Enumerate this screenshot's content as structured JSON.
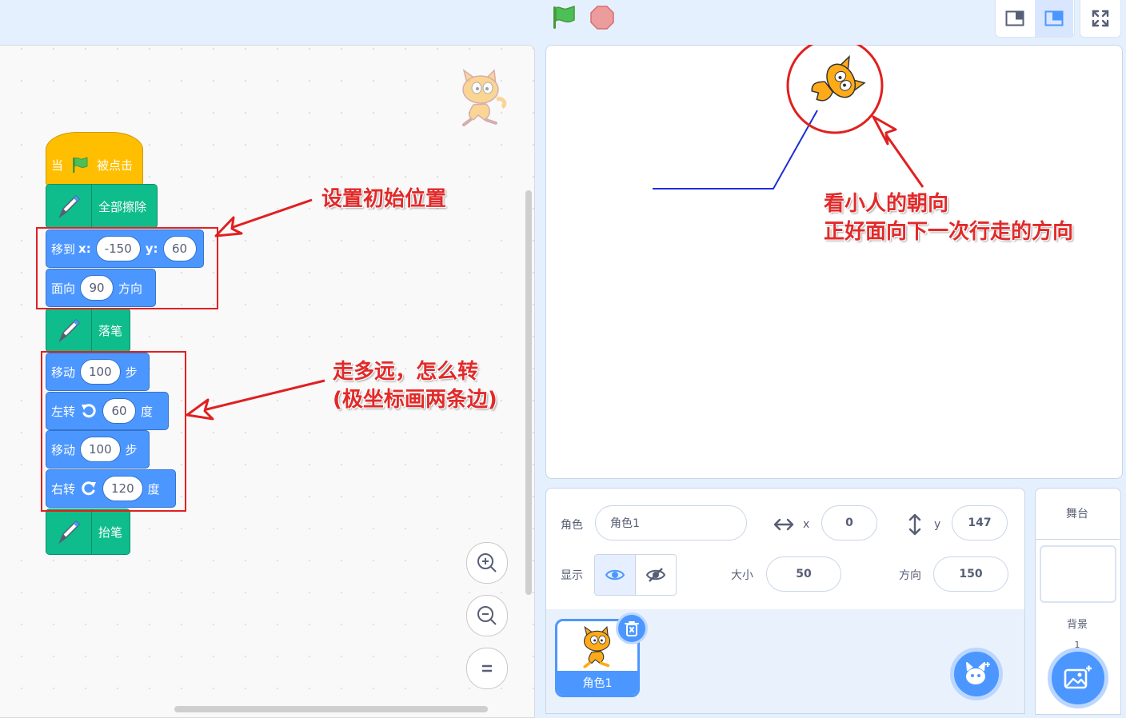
{
  "toolbar": {
    "green_flag": "green-flag-icon",
    "stop": "stop-icon",
    "layout_small": "small-stage-icon",
    "layout_normal": "normal-stage-icon",
    "fullscreen": "fullscreen-icon"
  },
  "blocks": {
    "hat_when": "当",
    "hat_clicked": "被点击",
    "clear_all": "全部擦除",
    "goto_label": "移到",
    "goto_x_label": "x:",
    "goto_x": "-150",
    "goto_y_label": "y:",
    "goto_y": "60",
    "point_label": "面向",
    "point_value": "90",
    "point_suffix": "方向",
    "pen_down": "落笔",
    "move1_label": "移动",
    "move1_value": "100",
    "move1_suffix": "步",
    "turn_left_label": "左转",
    "turn_left_value": "60",
    "turn_left_suffix": "度",
    "move2_label": "移动",
    "move2_value": "100",
    "move2_suffix": "步",
    "turn_right_label": "右转",
    "turn_right_value": "120",
    "turn_right_suffix": "度",
    "pen_up": "抬笔"
  },
  "annotations": {
    "initial_position": "设置初始位置",
    "distance_line1": "走多远，怎么转",
    "distance_line2": "(极坐标画两条边)",
    "stage_line1": "看小人的朝向",
    "stage_line2": "正好面向下一次行走的方向"
  },
  "sprite_info": {
    "sprite_label": "角色",
    "sprite_name": "角色1",
    "x_label": "x",
    "x_value": "0",
    "y_label": "y",
    "y_value": "147",
    "show_label": "显示",
    "size_label": "大小",
    "size_value": "50",
    "direction_label": "方向",
    "direction_value": "150"
  },
  "sprite_list": {
    "items": [
      {
        "name": "角色1"
      }
    ]
  },
  "stage_panel": {
    "title": "舞台",
    "backdrops_label": "背景",
    "backdrops_count": "1"
  },
  "colors": {
    "motion": "#4c97ff",
    "pen": "#0fbd8c",
    "events": "#ffbf00",
    "annotation": "#e02020",
    "pen_trail": "#1e2fd6"
  }
}
